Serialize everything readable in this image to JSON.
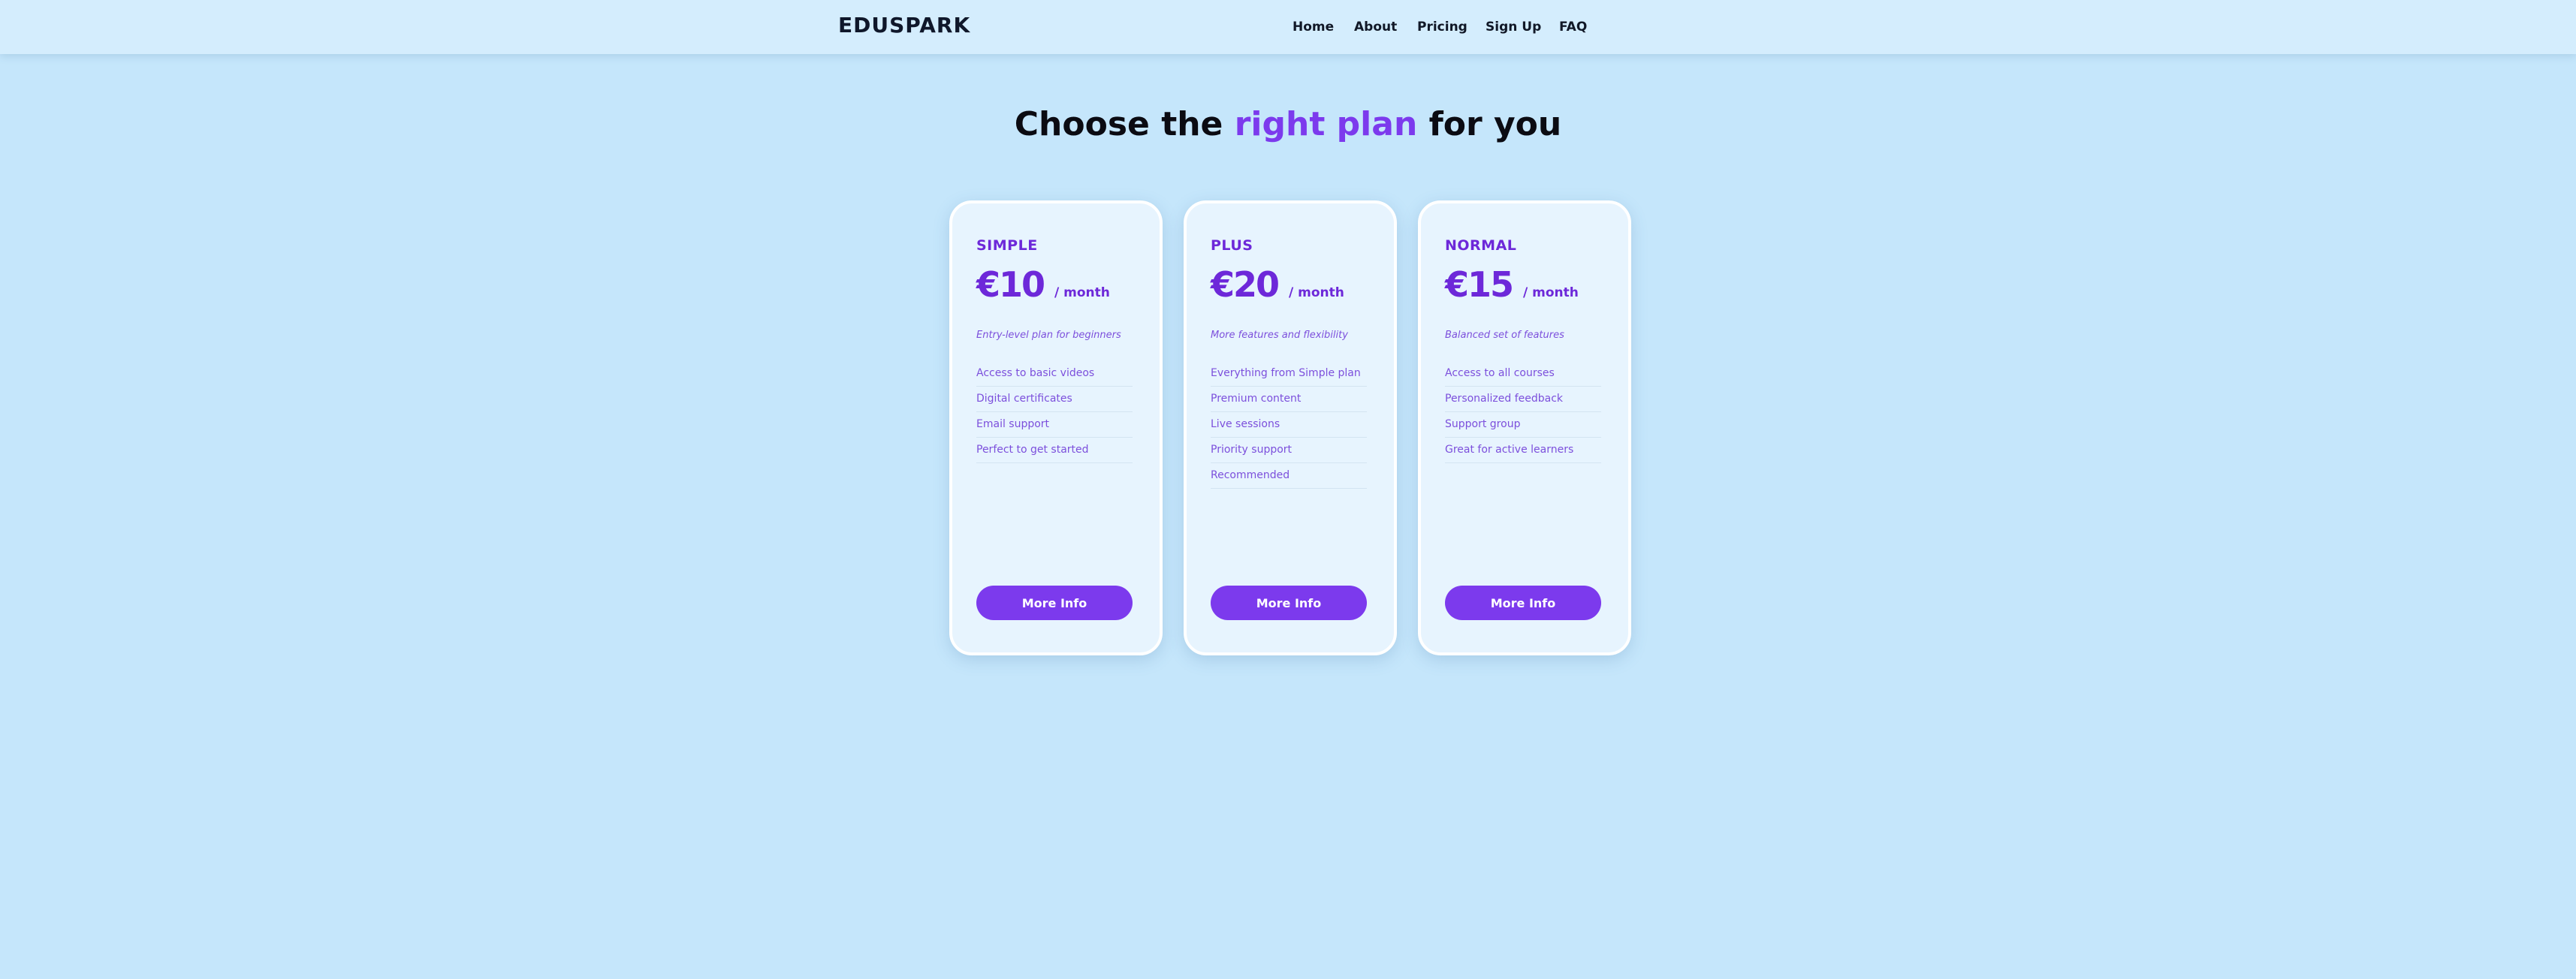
{
  "brand": "EDUSPARK",
  "nav": [
    "Home",
    "About",
    "Pricing",
    "Sign Up",
    "FAQ"
  ],
  "headline": {
    "before": "Choose the",
    "accent": "right plan",
    "after": "for you"
  },
  "colors": {
    "background": "#c5e6fb",
    "accent": "#7c3aed",
    "card": "#e7f4fe"
  },
  "plans": [
    {
      "name": "SIMPLE",
      "price": "€10",
      "period": "/ month",
      "description": "Entry-level plan for beginners",
      "features": [
        "Access to basic videos",
        "Digital certificates",
        "Email support",
        "Perfect to get started"
      ],
      "button": "More Info"
    },
    {
      "name": "PLUS",
      "price": "€20",
      "period": "/ month",
      "description": "More features and flexibility",
      "features": [
        "Everything from Simple plan",
        "Premium content",
        "Live sessions",
        "Priority support",
        "Recommended"
      ],
      "button": "More Info"
    },
    {
      "name": "NORMAL",
      "price": "€15",
      "period": "/ month",
      "description": "Balanced set of features",
      "features": [
        "Access to all courses",
        "Personalized feedback",
        "Support group",
        "Great for active learners"
      ],
      "button": "More Info"
    }
  ]
}
